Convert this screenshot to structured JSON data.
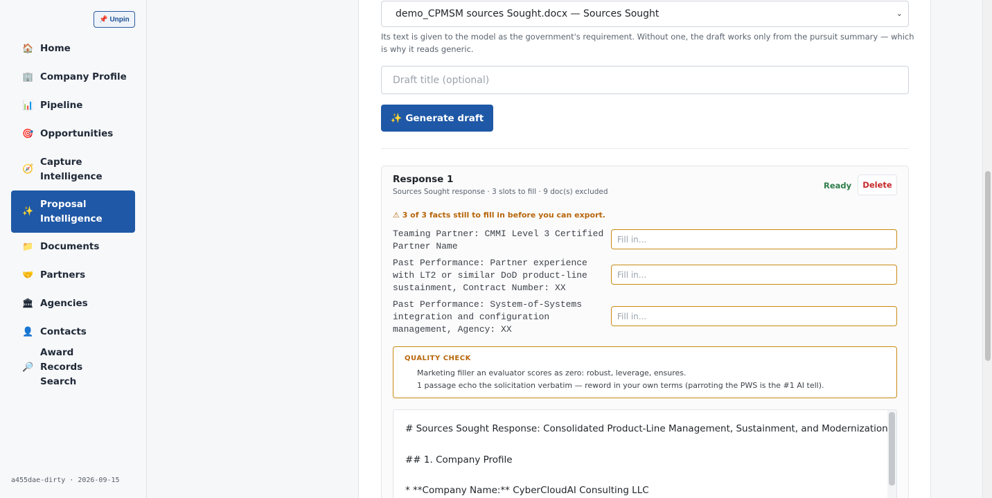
{
  "sidebar": {
    "unpin_label": "📌 Unpin",
    "items": [
      {
        "icon": "🏠",
        "icon_name": "home-icon",
        "label": "Home"
      },
      {
        "icon": "🏢",
        "icon_name": "building-icon",
        "label": "Company Profile"
      },
      {
        "icon": "📊",
        "icon_name": "bar-chart-icon",
        "label": "Pipeline"
      },
      {
        "icon": "🎯",
        "icon_name": "target-icon",
        "label": "Opportunities"
      },
      {
        "icon": "🧭",
        "icon_name": "compass-icon",
        "label": "Capture Intelligence"
      },
      {
        "icon": "✨",
        "icon_name": "sparkles-icon",
        "label": "Proposal Intelligence"
      },
      {
        "icon": "📁",
        "icon_name": "folder-icon",
        "label": "Documents"
      },
      {
        "icon": "🤝",
        "icon_name": "handshake-icon",
        "label": "Partners"
      },
      {
        "icon": "🏛",
        "icon_name": "institution-icon",
        "label": "Agencies"
      },
      {
        "icon": "👤",
        "icon_name": "person-icon",
        "label": "Contacts"
      },
      {
        "icon": "🔎",
        "icon_name": "magnifier-icon",
        "label": "Award Records Search"
      }
    ],
    "active_item": "Proposal Intelligence",
    "version": "a455dae-dirty · 2026-09-15"
  },
  "form": {
    "document_select": "demo_CPMSM sources Sought.docx — Sources Sought",
    "help_text": "Its text is given to the model as the government's requirement. Without one, the draft works only from the pursuit summary — which is why it reads generic.",
    "title_placeholder": "Draft title (optional)",
    "title_value": "",
    "generate_label": "✨ Generate draft"
  },
  "response": {
    "title": "Response 1",
    "subtitle": "Sources Sought response · 3 slots to fill · 9 doc(s) excluded",
    "status": "Ready",
    "delete_label": "Delete",
    "warning": "⚠ 3 of 3 facts still to fill in before you can export.",
    "facts": [
      {
        "label": "Teaming Partner: CMMI Level 3 Certified Partner Name",
        "placeholder": "Fill in...",
        "value": ""
      },
      {
        "label": "Past Performance: Partner experience with LT2 or similar DoD product-line sustainment, Contract Number: XX",
        "placeholder": "Fill in...",
        "value": ""
      },
      {
        "label": "Past Performance: System-of-Systems integration and configuration management, Agency: XX",
        "placeholder": "Fill in...",
        "value": ""
      }
    ],
    "quality_check": {
      "title": "QUALITY CHECK",
      "lines": [
        "Marketing filler an evaluator scores as zero: robust, leverage, ensures.",
        "1 passage echo the solicitation verbatim — reword in your own terms (parroting the PWS is the #1 AI tell)."
      ]
    },
    "draft_lines": [
      "# Sources Sought Response: Consolidated Product-Line Management, Sustainment, and Modernization (CPMSM)",
      "## 1. Company Profile",
      "*  **Company Name:** CyberCloudAI Consulting LLC"
    ]
  },
  "colors": {
    "accent": "#1f58a6",
    "warning": "#c88a12",
    "ready": "#2e7d4a",
    "danger": "#c62828"
  }
}
